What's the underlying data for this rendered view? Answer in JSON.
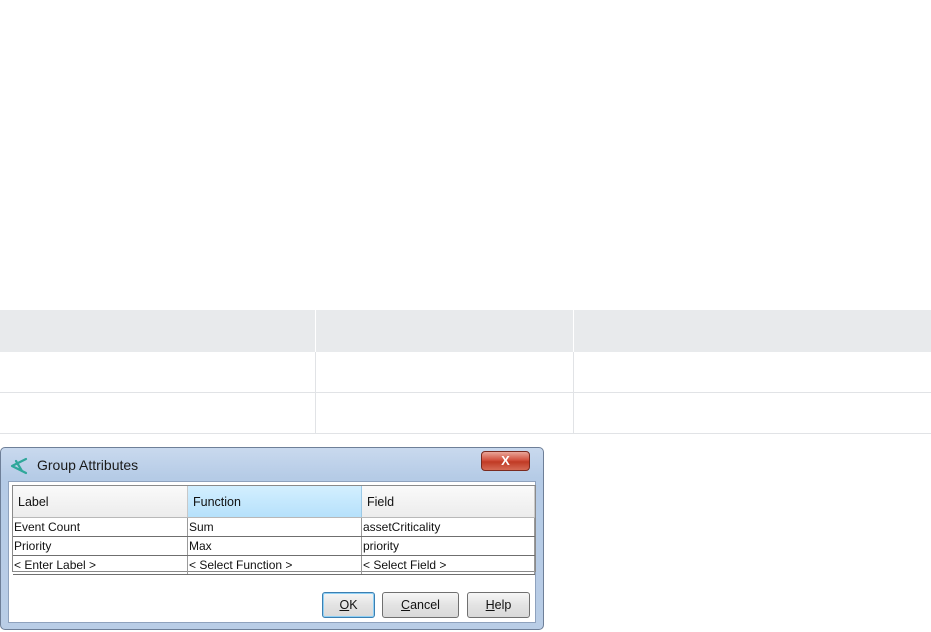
{
  "dialog": {
    "title": "Group Attributes",
    "close_label": "X",
    "columns": [
      "Label",
      "Function",
      "Field"
    ],
    "rows": [
      [
        "Event Count",
        "Sum",
        "assetCriticality"
      ],
      [
        "Priority",
        "Max",
        "priority"
      ],
      [
        "< Enter Label >",
        "< Select Function >",
        "< Select Field >"
      ]
    ],
    "buttons": {
      "ok_mnemonic": "O",
      "ok_rest": "K",
      "cancel_mnemonic": "C",
      "cancel_rest": "ancel",
      "help_mnemonic": "H",
      "help_rest": "elp"
    }
  },
  "colors": {
    "close_button": "#c03a25",
    "selected_header": "#b6e1fb",
    "doc_header_bg": "#e8eaec"
  },
  "icons": {
    "app": "group-attributes-icon"
  }
}
